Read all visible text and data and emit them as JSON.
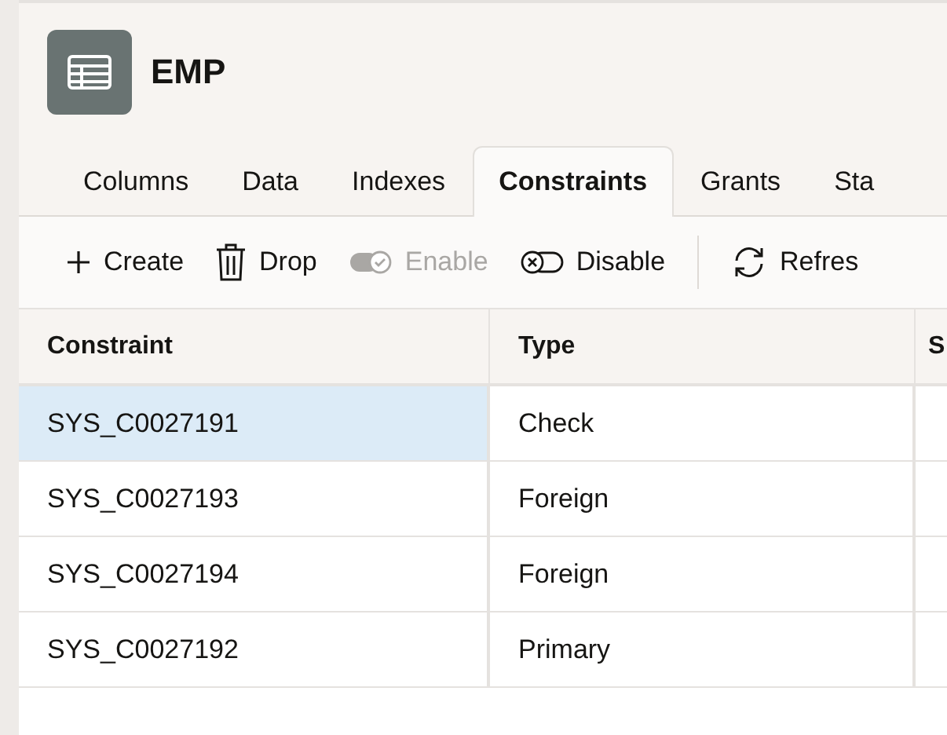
{
  "title": "EMP",
  "tabs": [
    {
      "label": "Columns",
      "selected": false
    },
    {
      "label": "Data",
      "selected": false
    },
    {
      "label": "Indexes",
      "selected": false
    },
    {
      "label": "Constraints",
      "selected": true
    },
    {
      "label": "Grants",
      "selected": false
    },
    {
      "label": "Sta",
      "selected": false
    }
  ],
  "toolbar": [
    {
      "kind": "create",
      "label": "Create",
      "disabled": false
    },
    {
      "kind": "drop",
      "label": "Drop",
      "disabled": false
    },
    {
      "kind": "enable",
      "label": "Enable",
      "disabled": true
    },
    {
      "kind": "disable",
      "label": "Disable",
      "disabled": false
    },
    {
      "kind": "refresh",
      "label": "Refres",
      "disabled": false
    }
  ],
  "table": {
    "columns": [
      "Constraint",
      "Type",
      "S"
    ],
    "rows": [
      {
        "cells": [
          "SYS_C0027191",
          "Check"
        ],
        "selected": true
      },
      {
        "cells": [
          "SYS_C0027193",
          "Foreign"
        ],
        "selected": false
      },
      {
        "cells": [
          "SYS_C0027194",
          "Foreign"
        ],
        "selected": false
      },
      {
        "cells": [
          "SYS_C0027192",
          "Primary"
        ],
        "selected": false
      }
    ]
  }
}
